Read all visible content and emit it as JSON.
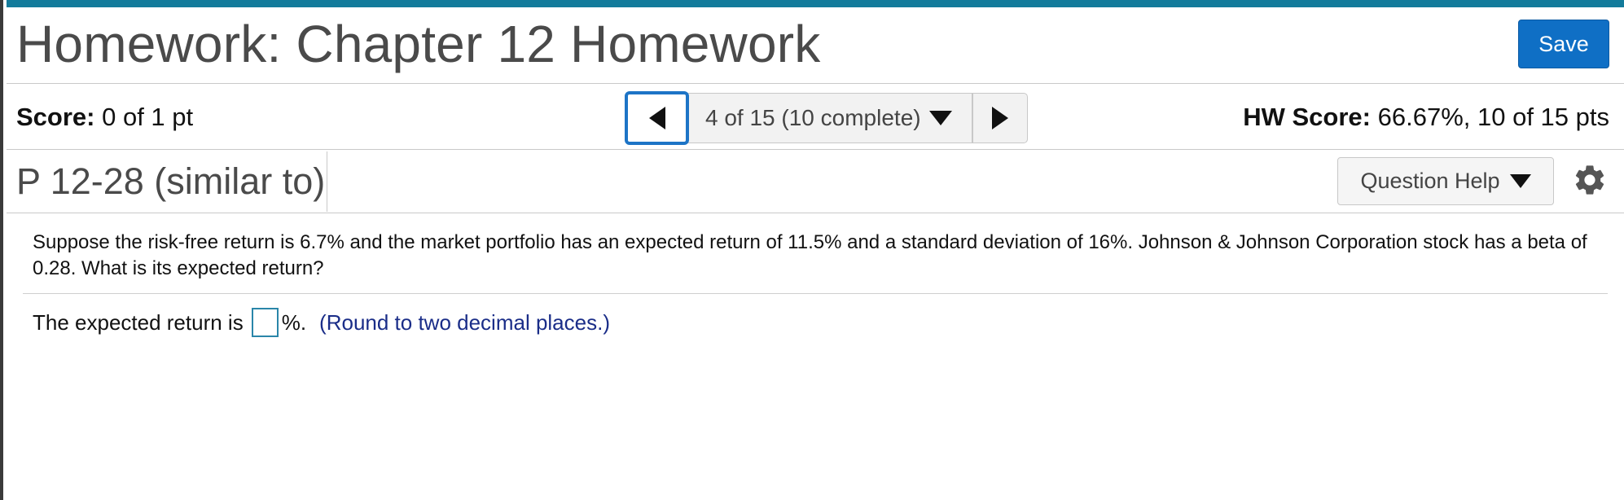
{
  "header": {
    "title": "Homework: Chapter 12 Homework",
    "save_label": "Save"
  },
  "score": {
    "label": "Score:",
    "value": "0 of 1 pt"
  },
  "navigator": {
    "position_text": "4 of 15 (10 complete)"
  },
  "hw_score": {
    "label": "HW Score:",
    "value": "66.67%, 10 of 15 pts"
  },
  "question": {
    "id_label": "P 12-28 (similar to)",
    "help_label": "Question Help",
    "prompt": "Suppose the risk-free return is 6.7% and the market portfolio has an expected return of 11.5% and a standard deviation of 16%. Johnson & Johnson Corporation stock has a beta of 0.28. What is its expected return?",
    "answer_prefix": "The expected return is",
    "answer_value": "",
    "answer_suffix": "%.",
    "hint": "(Round to two decimal places.)"
  },
  "colors": {
    "top_bar": "#137b9b",
    "save_button": "#0f6fc5",
    "hint_text": "#1a2d88",
    "input_border": "#2a86a9"
  },
  "icons": [
    "chevron-left-icon",
    "chevron-down-icon",
    "chevron-right-icon",
    "gear-icon"
  ]
}
